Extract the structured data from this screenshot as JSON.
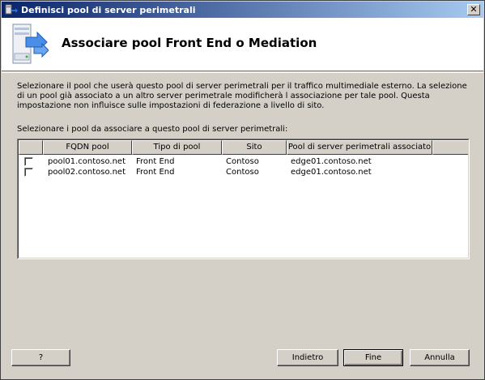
{
  "window": {
    "title": "Definisci pool di server perimetrali",
    "close_label": "✕"
  },
  "header": {
    "title": "Associare pool Front End o Mediation"
  },
  "description": "Selezionare il pool che userà questo pool di server perimetrali per il traffico multimediale esterno. La selezione di un pool già associato a un altro server perimetrale modificherà l associazione per tale pool. Questa impostazione non influisce sulle impostazioni di federazione a livello di sito.",
  "list_label": "Selezionare i pool da associare a questo pool di server perimetrali:",
  "table": {
    "columns": [
      "",
      "FQDN pool",
      "Tipo di pool",
      "Sito",
      "Pool di server perimetrali associato",
      ""
    ],
    "rows": [
      {
        "checked": false,
        "fqdn": "pool01.contoso.net",
        "type": "Front End",
        "site": "Contoso",
        "edge": "edge01.contoso.net"
      },
      {
        "checked": false,
        "fqdn": "pool02.contoso.net",
        "type": "Front End",
        "site": "Contoso",
        "edge": "edge01.contoso.net"
      }
    ]
  },
  "buttons": {
    "help": "?",
    "back": "Indietro",
    "finish": "Fine",
    "cancel": "Annulla"
  },
  "icons": {
    "title_icon": "server-network-icon",
    "header_icon": "server-arrow-icon"
  }
}
